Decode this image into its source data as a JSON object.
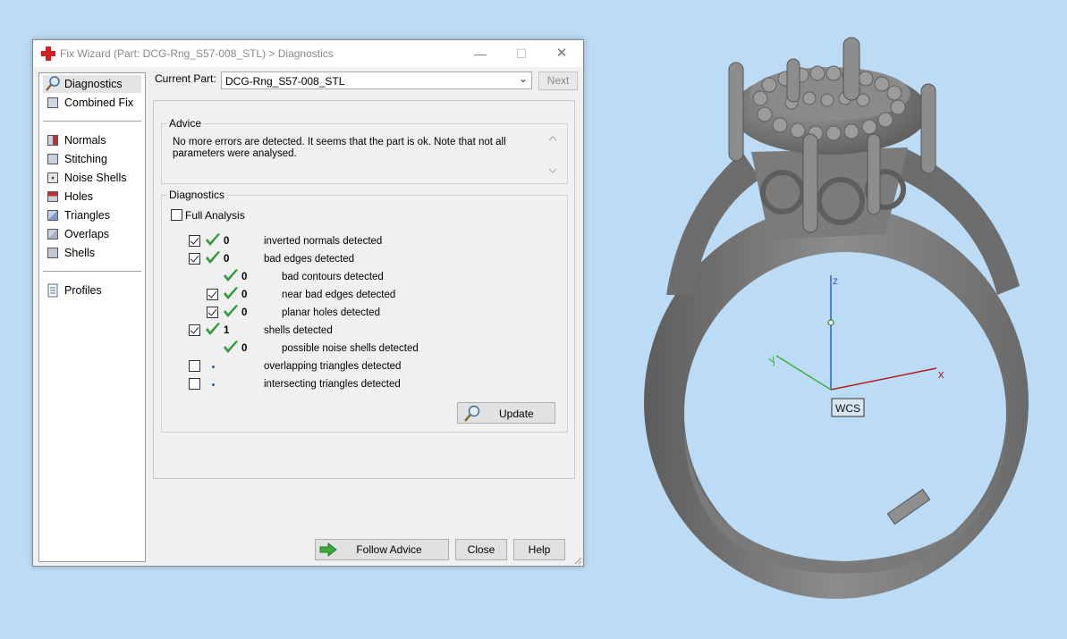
{
  "window": {
    "title": "Fix Wizard (Part: DCG-Rng_S57-008_STL) > Diagnostics",
    "app_icon": "red-cross-icon",
    "minimize_glyph": "—",
    "maximize_glyph": "☐",
    "close_glyph": "✕"
  },
  "sidebar": {
    "items": [
      {
        "label": "Diagnostics",
        "icon": "magnifier-icon",
        "selected": true
      },
      {
        "label": "Combined Fix",
        "icon": "cube-icon"
      },
      {
        "label": "Normals",
        "icon": "cube-red-icon"
      },
      {
        "label": "Stitching",
        "icon": "cube-icon"
      },
      {
        "label": "Noise Shells",
        "icon": "dice-icon"
      },
      {
        "label": "Holes",
        "icon": "cube-red-icon"
      },
      {
        "label": "Triangles",
        "icon": "cube-blue-icon"
      },
      {
        "label": "Overlaps",
        "icon": "cube-icon"
      },
      {
        "label": "Shells",
        "icon": "cube-icon"
      },
      {
        "label": "Profiles",
        "icon": "document-icon"
      }
    ]
  },
  "current_part": {
    "label": "Current Part:",
    "value": "DCG-Rng_S57-008_STL",
    "next_label": "Next"
  },
  "advice": {
    "legend": "Advice",
    "text": "No more errors are detected. It seems that the part is ok. Note that not all parameters were analysed."
  },
  "diagnostics": {
    "legend": "Diagnostics",
    "full_analysis_label": "Full Analysis",
    "full_analysis_checked": false,
    "rows": [
      {
        "checkbox": true,
        "checked": true,
        "status": "ok",
        "count": "0",
        "label": "inverted normals detected",
        "indent": 0
      },
      {
        "checkbox": true,
        "checked": true,
        "status": "ok",
        "count": "0",
        "label": "bad edges detected",
        "indent": 0
      },
      {
        "checkbox": false,
        "checked": false,
        "status": "ok",
        "count": "0",
        "label": "bad contours detected",
        "indent": 1
      },
      {
        "checkbox": true,
        "checked": true,
        "status": "ok",
        "count": "0",
        "label": "near bad edges detected",
        "indent": 1
      },
      {
        "checkbox": true,
        "checked": true,
        "status": "ok",
        "count": "0",
        "label": "planar holes detected",
        "indent": 1
      },
      {
        "checkbox": true,
        "checked": true,
        "status": "ok",
        "count": "1",
        "label": "shells detected",
        "indent": 0
      },
      {
        "checkbox": false,
        "checked": false,
        "status": "ok",
        "count": "0",
        "label": "possible noise shells detected",
        "indent": 1
      },
      {
        "checkbox": true,
        "checked": false,
        "status": "pending",
        "count": "",
        "label": "overlapping triangles detected",
        "indent": 0
      },
      {
        "checkbox": true,
        "checked": false,
        "status": "pending",
        "count": "",
        "label": "intersecting triangles detected",
        "indent": 0
      }
    ],
    "update_label": "Update"
  },
  "buttons": {
    "follow_advice": "Follow Advice",
    "close": "Close",
    "help": "Help"
  },
  "viewport": {
    "background": "#bcdcf5",
    "axis_z": "z",
    "axis_x": "x",
    "axis_y": "y",
    "wcs_label": "WCS",
    "axis_colors": {
      "x": "#b02020",
      "y": "#3bb03b",
      "z": "#2d62c8"
    }
  }
}
